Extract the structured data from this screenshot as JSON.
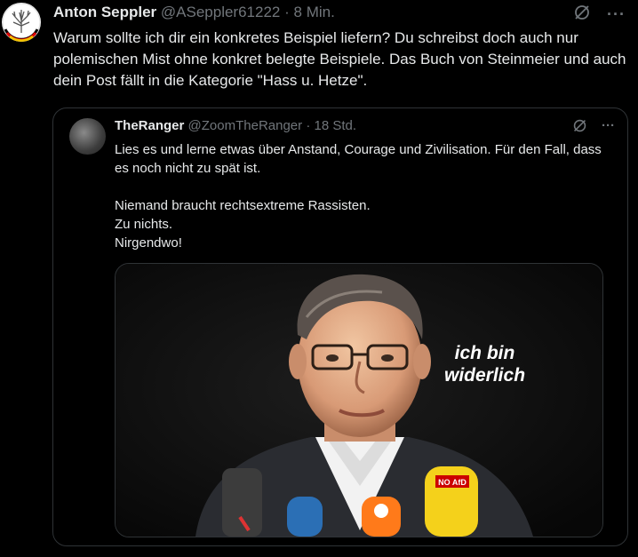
{
  "tweet": {
    "author_name": "Anton Seppler",
    "handle": "@ASeppler61222",
    "separator": "·",
    "time": "8 Min.",
    "text": "Warum sollte ich dir ein konkretes Beispiel liefern? Du schreibst doch auch nur polemischen Mist ohne konkret belegte Beispiele.  Das Buch von Steinmeier und auch dein Post fällt in die Kategorie \"Hass u. Hetze\".",
    "more_icon": "more-icon",
    "grok_icon": "grok-icon"
  },
  "quote": {
    "author_name": "TheRanger",
    "handle": "@ZoomTheRanger",
    "separator": "·",
    "time": "18 Std.",
    "lines": [
      "Lies es und lerne etwas über Anstand, Courage und Zivilisation. Für den Fall, dass es noch nicht zu spät ist.",
      "",
      "Niemand braucht rechtsextreme Rassisten.",
      "Zu nichts.",
      "Nirgendwo!"
    ],
    "media_caption_line1": "ich bin",
    "media_caption_line2": "widerlich",
    "mic_label": "NO AfD"
  },
  "colors": {
    "background": "#000000",
    "text": "#e7e9ea",
    "secondary": "#71767b",
    "border": "#2f3336"
  }
}
